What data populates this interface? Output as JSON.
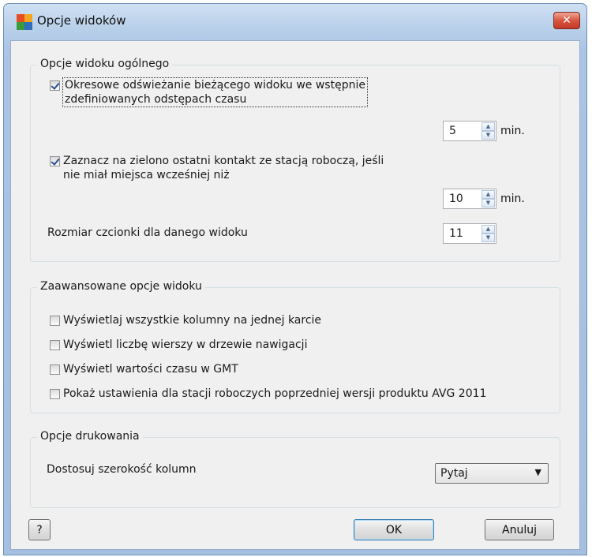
{
  "window": {
    "title": "Opcje widoków",
    "close_glyph": "✕"
  },
  "general": {
    "title": "Opcje widoku ogólnego",
    "refresh": {
      "label_line1": "Okresowe odświeżanie bieżącego widoku we wstępnie",
      "label_line2": "zdefiniowanych odstępach czasu",
      "checked": true,
      "value": "5",
      "unit": "min."
    },
    "green_mark": {
      "label_line1": "Zaznacz na zielono ostatni kontakt ze stacją roboczą, jeśli",
      "label_line2": "nie miał miejsca wcześniej niż",
      "checked": true,
      "value": "10",
      "unit": "min."
    },
    "font_size": {
      "label": "Rozmiar czcionki dla danego widoku",
      "value": "11"
    }
  },
  "advanced": {
    "title": "Zaawansowane opcje widoku",
    "options": [
      {
        "label": "Wyświetlaj wszystkie kolumny na jednej karcie",
        "checked": false
      },
      {
        "label": "Wyświetl liczbę wierszy w drzewie nawigacji",
        "checked": false
      },
      {
        "label": "Wyświetl wartości czasu w GMT",
        "checked": false
      },
      {
        "label": "Pokaż ustawienia dla stacji roboczych poprzedniej wersji produktu AVG 2011",
        "checked": false
      }
    ]
  },
  "printing": {
    "title": "Opcje drukowania",
    "column_width_label": "Dostosuj szerokość kolumn",
    "column_width_value": "Pytaj"
  },
  "buttons": {
    "help": "?",
    "ok": "OK",
    "cancel": "Anuluj"
  },
  "colors": {
    "titlebar": "#b9d0ea",
    "client": "#f0f0f0",
    "close": "#d8553f"
  }
}
